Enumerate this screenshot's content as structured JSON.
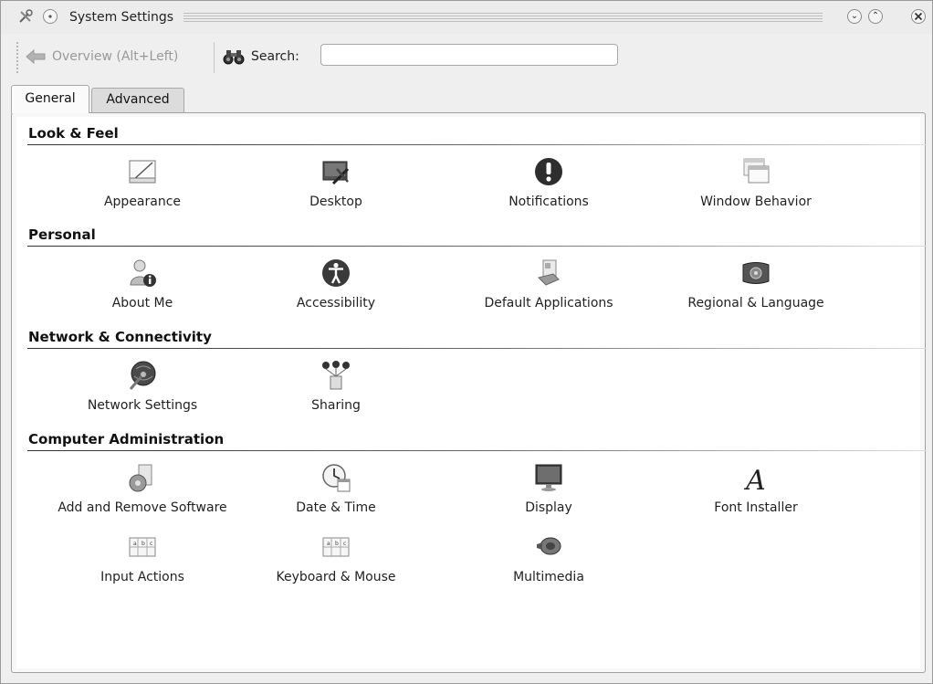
{
  "window": {
    "title": "System Settings"
  },
  "toolbar": {
    "back_label": "Overview (Alt+Left)",
    "search_label": "Search:",
    "search_value": "",
    "search_placeholder": ""
  },
  "tabs": [
    {
      "label": "General",
      "active": true
    },
    {
      "label": "Advanced",
      "active": false
    }
  ],
  "sections": [
    {
      "title": "Look & Feel",
      "items": [
        {
          "label": "Appearance",
          "icon": "appearance-icon"
        },
        {
          "label": "Desktop",
          "icon": "desktop-icon"
        },
        {
          "label": "Notifications",
          "icon": "notifications-icon"
        },
        {
          "label": "Window Behavior",
          "icon": "window-behavior-icon"
        }
      ]
    },
    {
      "title": "Personal",
      "items": [
        {
          "label": "About Me",
          "icon": "about-me-icon"
        },
        {
          "label": "Accessibility",
          "icon": "accessibility-icon"
        },
        {
          "label": "Default Applications",
          "icon": "default-applications-icon"
        },
        {
          "label": "Regional & Language",
          "icon": "regional-language-icon"
        }
      ]
    },
    {
      "title": "Network & Connectivity",
      "items": [
        {
          "label": "Network Settings",
          "icon": "network-settings-icon"
        },
        {
          "label": "Sharing",
          "icon": "sharing-icon"
        }
      ]
    },
    {
      "title": "Computer Administration",
      "items": [
        {
          "label": "Add and Remove Software",
          "icon": "add-remove-software-icon"
        },
        {
          "label": "Date & Time",
          "icon": "date-time-icon"
        },
        {
          "label": "Display",
          "icon": "display-icon"
        },
        {
          "label": "Font Installer",
          "icon": "font-installer-icon"
        },
        {
          "label": "Input Actions",
          "icon": "input-actions-icon"
        },
        {
          "label": "Keyboard & Mouse",
          "icon": "keyboard-mouse-icon"
        },
        {
          "label": "Multimedia",
          "icon": "multimedia-icon"
        }
      ]
    }
  ]
}
